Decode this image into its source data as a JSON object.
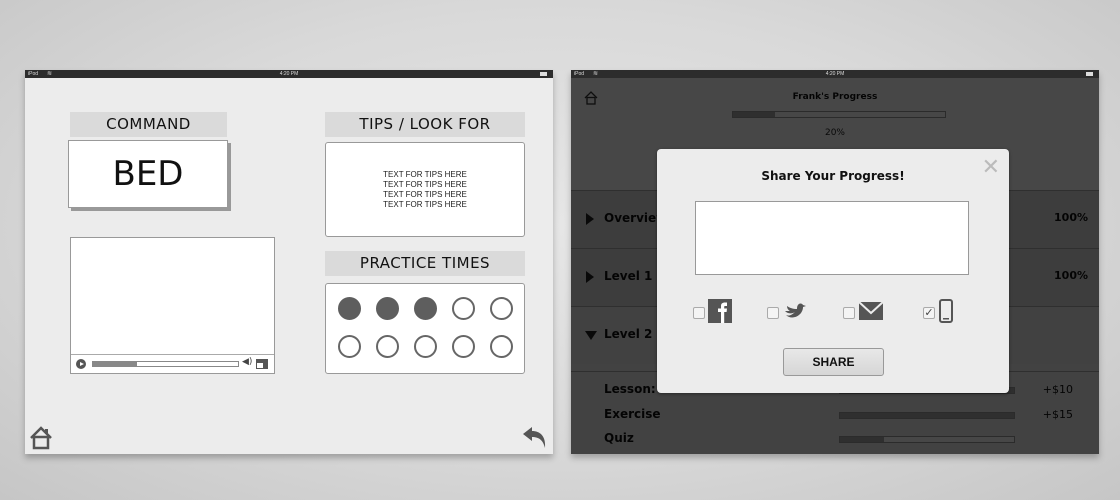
{
  "statusbar": {
    "carrier": "iPod",
    "time": "4:20 PM"
  },
  "left_app": {
    "command": {
      "label": "COMMAND",
      "word": "BED"
    },
    "video": {
      "progress_percent": 30
    },
    "tips": {
      "label": "TIPS / LOOK FOR",
      "lines": [
        "TEXT FOR TIPS HERE",
        "TEXT FOR TIPS HERE",
        "TEXT FOR TIPS HERE",
        "TEXT FOR TIPS HERE"
      ]
    },
    "practice": {
      "label": "PRACTICE TIMES",
      "completed": 3,
      "total": 10
    },
    "nav": {
      "home": "home-icon",
      "back": "back-arrow-icon"
    }
  },
  "right_app": {
    "title": "Frank's Progress",
    "progress_percent": 20,
    "progress_label": "20%",
    "sections": [
      {
        "name": "Overview",
        "value": "100%",
        "expanded": false
      },
      {
        "name": "Level 1",
        "value": "100%",
        "expanded": false
      },
      {
        "name": "Level 2",
        "value": "",
        "expanded": true
      }
    ],
    "level2_items": [
      {
        "name": "Lesson: ",
        "progress_percent": 100,
        "reward": "+$10"
      },
      {
        "name": "Exercise",
        "progress_percent": 100,
        "reward": "+$15"
      },
      {
        "name": "Quiz",
        "progress_percent": 25,
        "reward": ""
      }
    ],
    "modal": {
      "title": "Share Your Progress!",
      "message_value": "",
      "close_icon": "close-icon",
      "options": [
        {
          "name": "facebook",
          "icon": "facebook-icon",
          "checked": false
        },
        {
          "name": "twitter",
          "icon": "twitter-bird-icon",
          "checked": false
        },
        {
          "name": "email",
          "icon": "envelope-icon",
          "checked": false
        },
        {
          "name": "phone",
          "icon": "mobile-phone-icon",
          "checked": true
        }
      ],
      "share_label": "SHARE"
    }
  }
}
